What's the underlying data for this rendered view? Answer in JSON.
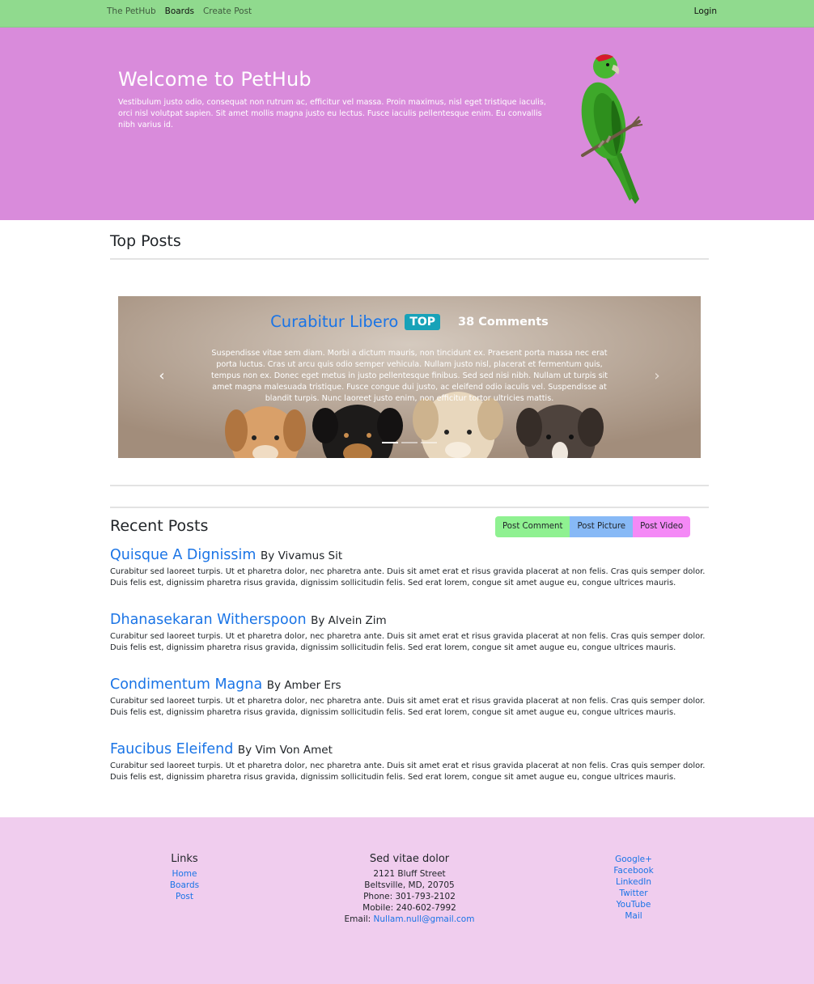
{
  "nav": {
    "items": [
      {
        "label": "The PetHub"
      },
      {
        "label": "Boards"
      },
      {
        "label": "Create Post"
      }
    ],
    "login": "Login"
  },
  "hero": {
    "title": "Welcome to PetHub",
    "text": "Vestibulum justo odio, consequat non rutrum ac, efficitur vel massa. Proin maximus, nisl eget tristique iaculis, orci nisl volutpat sapien. Sit amet mollis magna justo eu lectus. Fusce iaculis pellentesque enim. Eu convallis nibh varius id."
  },
  "top_posts": {
    "title": "Top Posts",
    "carousel": {
      "title": "Curabitur Libero",
      "badge": "TOP",
      "comments": "38 Comments",
      "text": "Suspendisse vitae sem diam. Morbi a dictum mauris, non tincidunt ex. Praesent porta massa nec erat porta luctus. Cras ut arcu quis odio semper vehicula. Nullam justo nisl, placerat et fermentum quis, tempus non ex. Donec eget metus in justo pellentesque finibus. Sed sed nisi nibh. Nullam ut turpis sit amet magna malesuada tristique. Fusce congue dui justo, ac eleifend odio iaculis vel. Suspendisse at blandit turpis. Nunc laoreet justo enim, non efficitur tortor ultricies mattis.",
      "prev": "‹",
      "next": "›"
    }
  },
  "recent": {
    "title": "Recent Posts",
    "buttons": {
      "comment": "Post Comment",
      "picture": "Post Picture",
      "video": "Post Video"
    },
    "posts": [
      {
        "title": "Quisque A Dignissim",
        "author": "By Vivamus Sit",
        "body": "Curabitur sed laoreet turpis. Ut et pharetra dolor, nec pharetra ante. Duis sit amet erat et risus gravida placerat at non felis. Cras quis semper dolor. Duis felis est, dignissim pharetra risus gravida, dignissim sollicitudin felis. Sed erat lorem, congue sit amet augue eu, congue ultrices mauris."
      },
      {
        "title": "Dhanasekaran Witherspoon",
        "author": "By Alvein Zim",
        "body": "Curabitur sed laoreet turpis. Ut et pharetra dolor, nec pharetra ante. Duis sit amet erat et risus gravida placerat at non felis. Cras quis semper dolor. Duis felis est, dignissim pharetra risus gravida, dignissim sollicitudin felis. Sed erat lorem, congue sit amet augue eu, congue ultrices mauris."
      },
      {
        "title": "Condimentum Magna",
        "author": "By Amber Ers",
        "body": "Curabitur sed laoreet turpis. Ut et pharetra dolor, nec pharetra ante. Duis sit amet erat et risus gravida placerat at non felis. Cras quis semper dolor. Duis felis est, dignissim pharetra risus gravida, dignissim sollicitudin felis. Sed erat lorem, congue sit amet augue eu, congue ultrices mauris."
      },
      {
        "title": "Faucibus Eleifend",
        "author": "By Vim Von Amet",
        "body": "Curabitur sed laoreet turpis. Ut et pharetra dolor, nec pharetra ante. Duis sit amet erat et risus gravida placerat at non felis. Cras quis semper dolor. Duis felis est, dignissim pharetra risus gravida, dignissim sollicitudin felis. Sed erat lorem, congue sit amet augue eu, congue ultrices mauris."
      }
    ]
  },
  "footer": {
    "links": {
      "title": "Links",
      "items": [
        "Home",
        "Boards",
        "Post"
      ]
    },
    "address": {
      "title": "Sed vitae dolor",
      "street": "2121 Bluff Street",
      "city": "Beltsville, MD, 20705",
      "phone": "Phone: 301-793-2102",
      "mobile": "Mobile: 240-602-7992",
      "email_label": "Email:",
      "email": "Nullam.null@gmail.com"
    },
    "social": [
      "Google+",
      "Facebook",
      "LinkedIn",
      "Twitter",
      "YouTube",
      "Mail"
    ]
  },
  "colors": {
    "navbar": "#90da8e",
    "hero": "#d98bdb",
    "footer": "#f0cdee",
    "link": "#1a74e6",
    "badge": "#17a2b8"
  }
}
